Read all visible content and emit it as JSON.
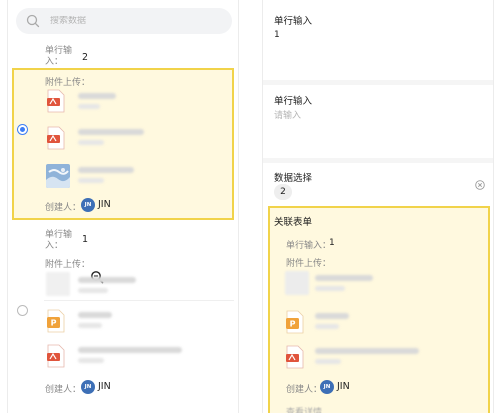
{
  "left": {
    "search_placeholder": "搜索数据",
    "records": [
      {
        "single_line_label": "单行输\n入：",
        "single_line_value": "2",
        "attachment_label": "附件上传：",
        "creator_label": "创建人：",
        "creator_avatar": "JN",
        "creator_name": "JIN",
        "selected": true
      },
      {
        "single_line_label": "单行输\n入：",
        "single_line_value": "1",
        "attachment_label": "附件上传：",
        "creator_label": "创建人：",
        "creator_avatar": "JN",
        "creator_name": "JIN",
        "selected": false
      }
    ]
  },
  "right": {
    "field1_label": "单行输入",
    "field1_value": "1",
    "field2_label": "单行输入",
    "field2_placeholder": "请输入",
    "data_select_label": "数据选择",
    "data_select_value": "2",
    "related_form_title": "关联表单",
    "related_single_line": "单行输入：",
    "related_single_value": "1",
    "related_attachment_label": "附件上传：",
    "related_creator_label": "创建人：",
    "related_creator_avatar": "JN",
    "related_creator_name": "JIN",
    "related_footer": "查看详情"
  },
  "colors": {
    "accent": "#3d7ef5",
    "highlight_border": "#f1d34a",
    "highlight_fill": "#fff4c4",
    "pdf_red": "#e0543c",
    "ppt_orange": "#f0a23a"
  },
  "icons": [
    "search-icon",
    "pdf-file-icon",
    "ppt-file-icon",
    "image-thumbnail",
    "zoom-icon",
    "clear-icon"
  ]
}
